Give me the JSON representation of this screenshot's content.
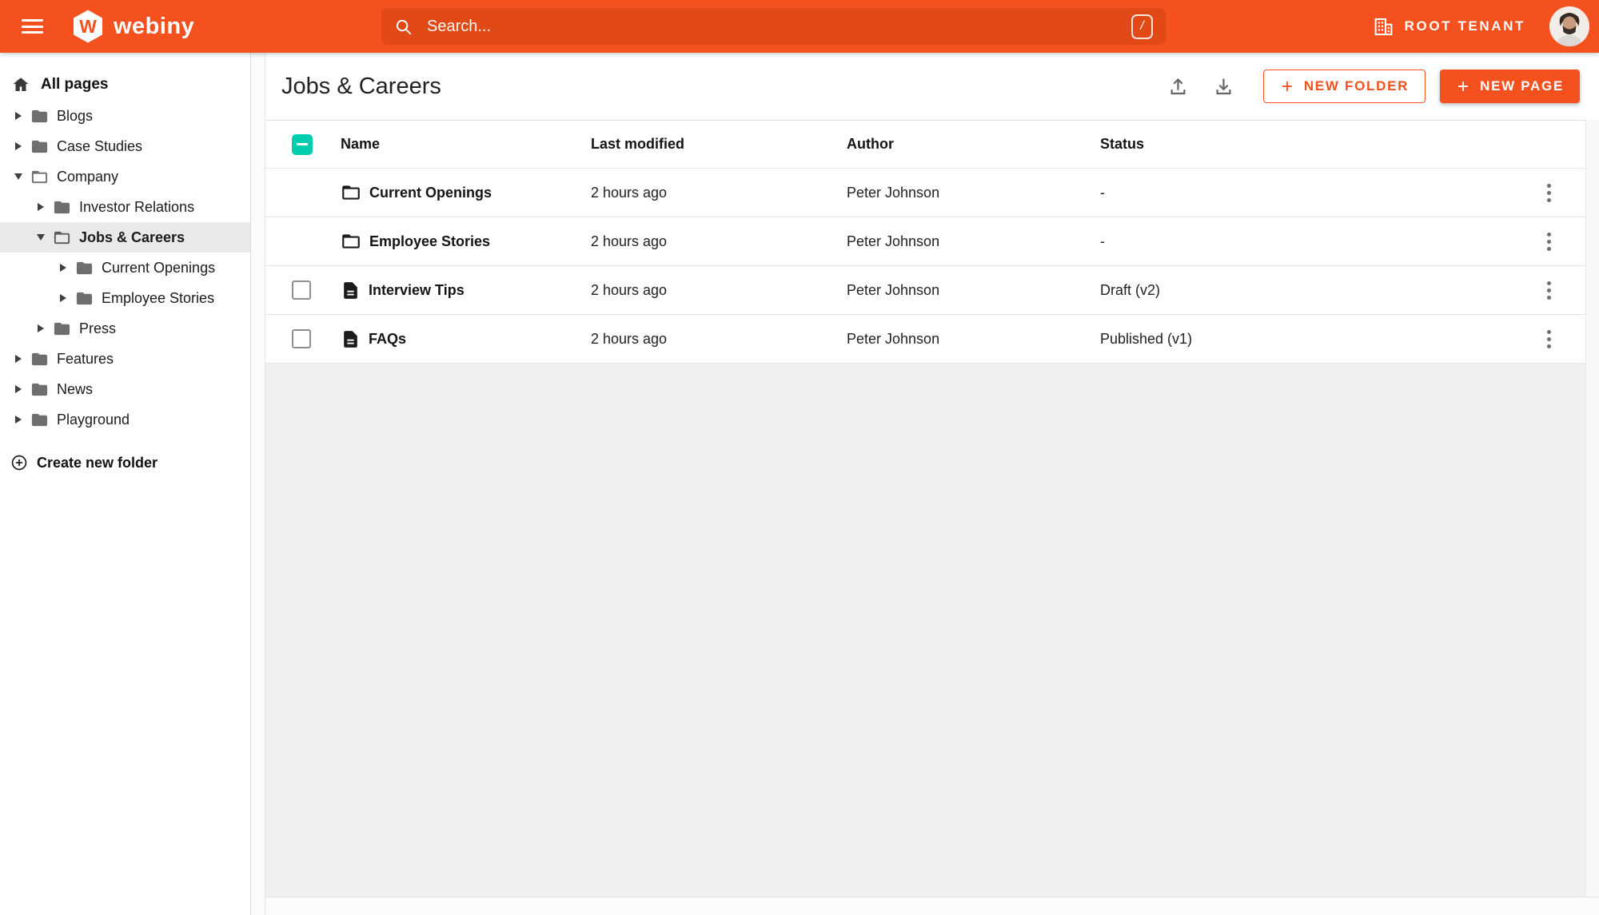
{
  "topbar": {
    "brand": "webiny",
    "logo_letter": "W",
    "search": {
      "placeholder": "Search...",
      "shortcut": "/"
    },
    "tenant_label": "ROOT TENANT"
  },
  "sidebar": {
    "root_label": "All pages",
    "create_label": "Create new folder",
    "items": [
      {
        "label": "Blogs",
        "level": 0,
        "state": "collapsed",
        "selected": false
      },
      {
        "label": "Case Studies",
        "level": 0,
        "state": "collapsed",
        "selected": false
      },
      {
        "label": "Company",
        "level": 0,
        "state": "expanded",
        "selected": false
      },
      {
        "label": "Investor Relations",
        "level": 1,
        "state": "collapsed",
        "selected": false
      },
      {
        "label": "Jobs & Careers",
        "level": 1,
        "state": "expanded",
        "selected": true
      },
      {
        "label": "Current Openings",
        "level": 2,
        "state": "collapsed",
        "selected": false
      },
      {
        "label": "Employee Stories",
        "level": 2,
        "state": "collapsed",
        "selected": false
      },
      {
        "label": "Press",
        "level": 1,
        "state": "collapsed",
        "selected": false
      },
      {
        "label": "Features",
        "level": 0,
        "state": "collapsed",
        "selected": false
      },
      {
        "label": "News",
        "level": 0,
        "state": "collapsed",
        "selected": false
      },
      {
        "label": "Playground",
        "level": 0,
        "state": "collapsed",
        "selected": false
      }
    ]
  },
  "content": {
    "title": "Jobs & Careers",
    "buttons": {
      "new_folder": "NEW FOLDER",
      "new_page": "NEW PAGE"
    },
    "table": {
      "headers": {
        "name": "Name",
        "modified": "Last modified",
        "author": "Author",
        "status": "Status"
      },
      "rows": [
        {
          "type": "folder",
          "name": "Current Openings",
          "modified": "2 hours ago",
          "author": "Peter Johnson",
          "status": "-",
          "has_checkbox": false
        },
        {
          "type": "folder",
          "name": "Employee Stories",
          "modified": "2 hours ago",
          "author": "Peter Johnson",
          "status": "-",
          "has_checkbox": false
        },
        {
          "type": "page",
          "name": "Interview Tips",
          "modified": "2 hours ago",
          "author": "Peter Johnson",
          "status": "Draft (v2)",
          "has_checkbox": true
        },
        {
          "type": "page",
          "name": "FAQs",
          "modified": "2 hours ago",
          "author": "Peter Johnson",
          "status": "Published (v1)",
          "has_checkbox": true
        }
      ]
    }
  },
  "colors": {
    "accent": "#f4511e",
    "accent_dark": "#e14a16",
    "secondary": "#00ccb0",
    "content_bg": "#f0f0f0"
  }
}
